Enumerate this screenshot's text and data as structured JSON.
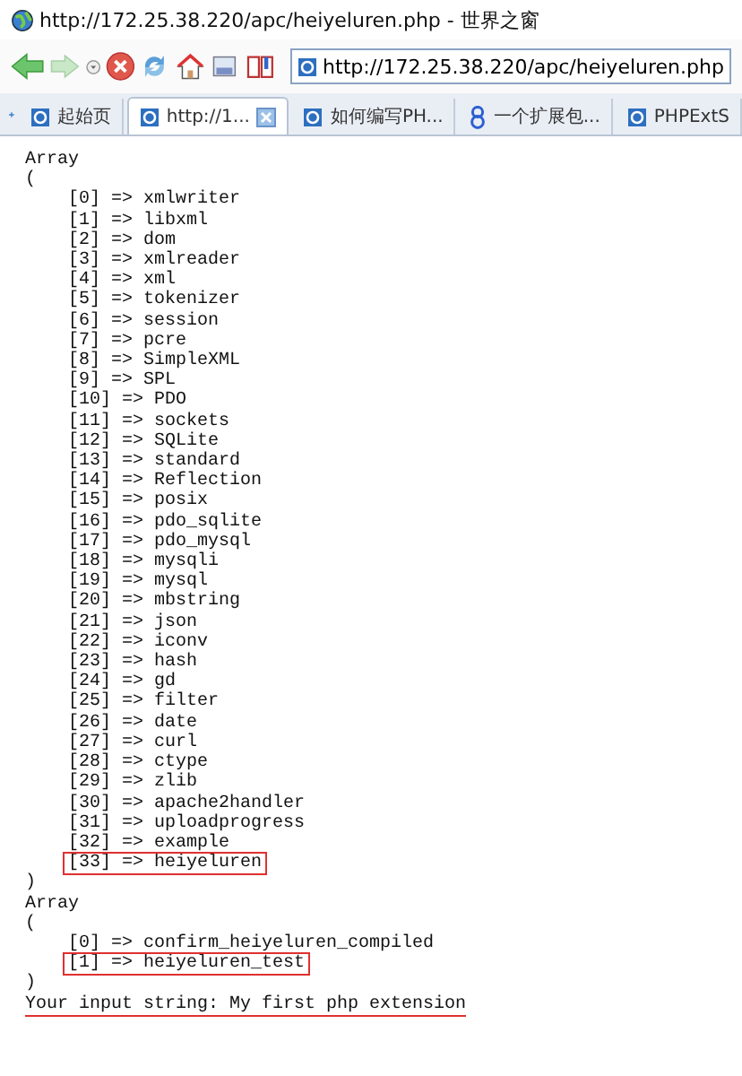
{
  "window": {
    "title": "http://172.25.38.220/apc/heiyeluren.php - 世界之窗"
  },
  "address": {
    "value": "http://172.25.38.220/apc/heiyeluren.php"
  },
  "tabs": [
    {
      "label": "起始页",
      "kind": "page",
      "selected": false,
      "closable": false
    },
    {
      "label": "http://1...",
      "kind": "page",
      "selected": true,
      "closable": true
    },
    {
      "label": "如何编写PH...",
      "kind": "page",
      "selected": false,
      "closable": false
    },
    {
      "label": "一个扩展包...",
      "kind": "loop",
      "selected": false,
      "closable": false
    },
    {
      "label": "PHPExtS",
      "kind": "page",
      "selected": false,
      "closable": false
    }
  ],
  "output": {
    "arrays": [
      {
        "heading": "Array",
        "open": "(",
        "close": ")",
        "items": [
          {
            "text": "[0] => xmlwriter",
            "highlighted": false
          },
          {
            "text": "[1] => libxml",
            "highlighted": false
          },
          {
            "text": "[2] => dom",
            "highlighted": false
          },
          {
            "text": "[3] => xmlreader",
            "highlighted": false
          },
          {
            "text": "[4] => xml",
            "highlighted": false
          },
          {
            "text": "[5] => tokenizer",
            "highlighted": false
          },
          {
            "text": "[6] => session",
            "highlighted": false
          },
          {
            "text": "[7] => pcre",
            "highlighted": false
          },
          {
            "text": "[8] => SimpleXML",
            "highlighted": false
          },
          {
            "text": "[9] => SPL",
            "highlighted": false
          },
          {
            "text": "[10] => PDO",
            "highlighted": false
          },
          {
            "text": "[11] => sockets",
            "highlighted": false
          },
          {
            "text": "[12] => SQLite",
            "highlighted": false
          },
          {
            "text": "[13] => standard",
            "highlighted": false
          },
          {
            "text": "[14] => Reflection",
            "highlighted": false
          },
          {
            "text": "[15] => posix",
            "highlighted": false
          },
          {
            "text": "[16] => pdo_sqlite",
            "highlighted": false
          },
          {
            "text": "[17] => pdo_mysql",
            "highlighted": false
          },
          {
            "text": "[18] => mysqli",
            "highlighted": false
          },
          {
            "text": "[19] => mysql",
            "highlighted": false
          },
          {
            "text": "[20] => mbstring",
            "highlighted": false
          },
          {
            "text": "[21] => json",
            "highlighted": false
          },
          {
            "text": "[22] => iconv",
            "highlighted": false
          },
          {
            "text": "[23] => hash",
            "highlighted": false
          },
          {
            "text": "[24] => gd",
            "highlighted": false
          },
          {
            "text": "[25] => filter",
            "highlighted": false
          },
          {
            "text": "[26] => date",
            "highlighted": false
          },
          {
            "text": "[27] => curl",
            "highlighted": false
          },
          {
            "text": "[28] => ctype",
            "highlighted": false
          },
          {
            "text": "[29] => zlib",
            "highlighted": false
          },
          {
            "text": "[30] => apache2handler",
            "highlighted": false
          },
          {
            "text": "[31] => uploadprogress",
            "highlighted": false
          },
          {
            "text": "[32] => example",
            "highlighted": false
          },
          {
            "text": "[33] => heiyeluren",
            "highlighted": true
          }
        ]
      },
      {
        "heading": "Array",
        "open": "(",
        "close": ")",
        "items": [
          {
            "text": "[0] => confirm_heiyeluren_compiled",
            "highlighted": false
          },
          {
            "text": "[1] => heiyeluren_test",
            "highlighted": true
          }
        ]
      }
    ],
    "message": {
      "text": "Your input string: My first php extension",
      "underlined": true
    }
  }
}
